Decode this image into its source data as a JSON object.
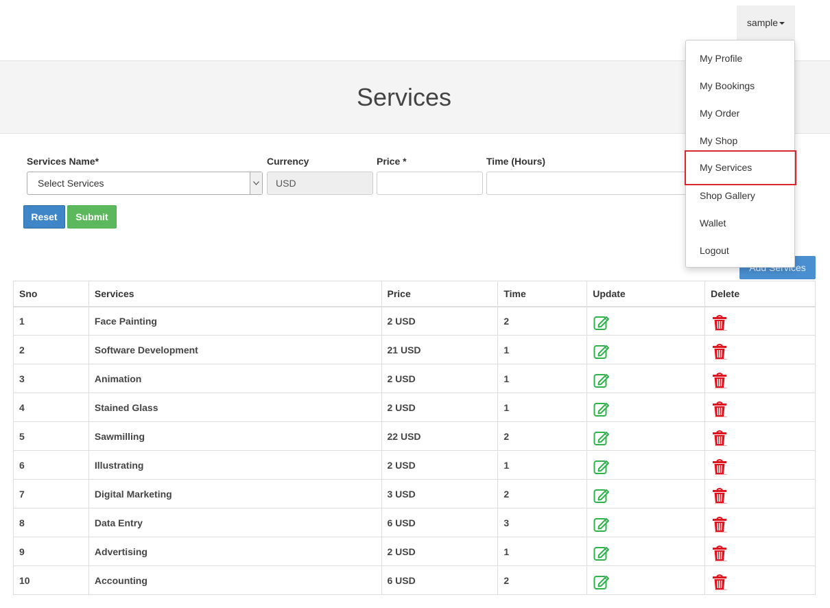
{
  "user_menu": {
    "username": "sample",
    "items": [
      "My Profile",
      "My Bookings",
      "My Order",
      "My Shop",
      "My Services",
      "Shop Gallery",
      "Wallet",
      "Logout"
    ],
    "highlighted": "My Services"
  },
  "page": {
    "title": "Services"
  },
  "form": {
    "service_name_label": "Services Name*",
    "service_select_value": "Select Services",
    "currency_label": "Currency",
    "currency_value": "USD",
    "price_label": "Price *",
    "time_label": "Time (Hours)",
    "reset_label": "Reset",
    "submit_label": "Submit",
    "add_label": "Add Services"
  },
  "table": {
    "headers": [
      "Sno",
      "Services",
      "Price",
      "Time",
      "Update",
      "Delete"
    ],
    "rows": [
      {
        "sno": "1",
        "service": "Face Painting",
        "price": "2 USD",
        "time": "2"
      },
      {
        "sno": "2",
        "service": "Software Development",
        "price": "21 USD",
        "time": "1"
      },
      {
        "sno": "3",
        "service": "Animation",
        "price": "2 USD",
        "time": "1"
      },
      {
        "sno": "4",
        "service": "Stained Glass",
        "price": "2 USD",
        "time": "1"
      },
      {
        "sno": "5",
        "service": "Sawmilling",
        "price": "22 USD",
        "time": "2"
      },
      {
        "sno": "6",
        "service": "Illustrating",
        "price": "2 USD",
        "time": "1"
      },
      {
        "sno": "7",
        "service": "Digital Marketing",
        "price": "3 USD",
        "time": "2"
      },
      {
        "sno": "8",
        "service": "Data Entry",
        "price": "6 USD",
        "time": "3"
      },
      {
        "sno": "9",
        "service": "Advertising",
        "price": "2 USD",
        "time": "1"
      },
      {
        "sno": "10",
        "service": "Accounting",
        "price": "6 USD",
        "time": "2"
      }
    ]
  },
  "icons": {
    "update": "edit-icon",
    "delete": "trash-icon",
    "dropdown": "chevron-down-icon"
  },
  "colors": {
    "update_icon": "#2db34a",
    "delete_icon": "#e0141e",
    "highlight": "#d9262d",
    "reset": "#3f86c8",
    "submit": "#5cb85c"
  }
}
